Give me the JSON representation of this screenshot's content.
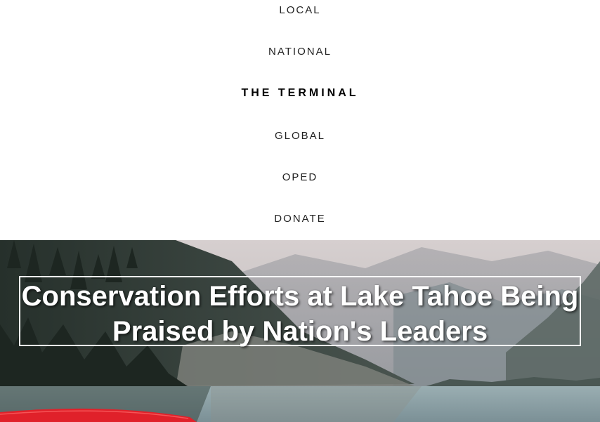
{
  "nav": {
    "items": [
      {
        "label": "LOCAL"
      },
      {
        "label": "NATIONAL"
      },
      {
        "label": "THE TERMINAL"
      },
      {
        "label": "GLOBAL"
      },
      {
        "label": "OPED"
      },
      {
        "label": "DONATE"
      }
    ],
    "active_label": "THE TERMINAL"
  },
  "hero": {
    "headline": "Conservation Efforts at Lake Tahoe Being Praised by Nation's Leaders",
    "image_description_icon": "lake-forest-photo",
    "colors": {
      "sky": "#c9c4c4",
      "water": "#8fa3a8",
      "forest": "#2f3a34",
      "kayak": "#e0212a"
    }
  }
}
